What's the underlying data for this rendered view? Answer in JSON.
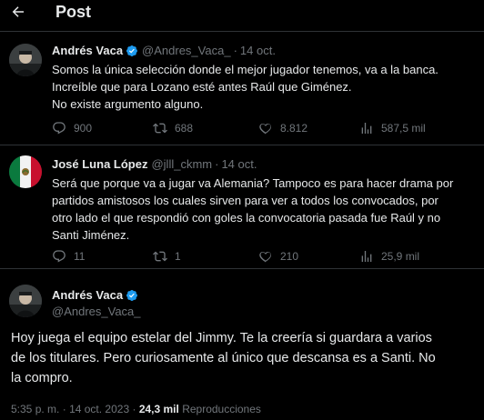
{
  "header": {
    "back_icon": "arrow-left-icon",
    "title": "Post"
  },
  "colors": {
    "background": "#000000",
    "text_primary": "#e7e9ea",
    "text_secondary": "#71767b",
    "divider": "#2f3336",
    "verified": "#1d9bf0"
  },
  "replies": [
    {
      "display_name": "Andrés Vaca",
      "verified": true,
      "handle": "@Andres_Vaca_",
      "separator": "·",
      "date": "14 oct.",
      "lines": [
        "Somos la única selección donde el mejor jugador tenemos, va a la banca.",
        "Increíble que para Lozano esté antes Raúl que Giménez.",
        "No existe argumento alguno."
      ],
      "stats": {
        "replies": "900",
        "reposts": "688",
        "likes": "8.812",
        "views": "587,5 mil"
      }
    },
    {
      "display_name": "José Luna López",
      "verified": false,
      "handle": "@jlll_ckmm",
      "separator": "·",
      "date": "14 oct.",
      "lines": [
        "Será que porque va a jugar va Alemania? Tampoco es para hacer drama por",
        "partidos amistosos los cuales sirven para ver a todos los convocados, por",
        "otro lado el que respondió con goles la convocatoria pasada fue Raúl y no",
        "Santi Jiménez."
      ],
      "stats": {
        "replies": "11",
        "reposts": "1",
        "likes": "210",
        "views": "25,9 mil"
      }
    }
  ],
  "main_post": {
    "display_name": "Andrés Vaca",
    "verified": true,
    "handle": "@Andres_Vaca_",
    "lines": [
      "Hoy juega el equipo estelar del Jimmy. Te la creería si guardara a varios",
      "de los titulares. Pero curiosamente al único que descansa es a Santi. No",
      "la compro."
    ],
    "time": "5:35 p. m.",
    "separator": "·",
    "date": "14 oct. 2023",
    "separator2": "·",
    "views_count": "24,3 mil",
    "views_label": "Reproducciones"
  }
}
